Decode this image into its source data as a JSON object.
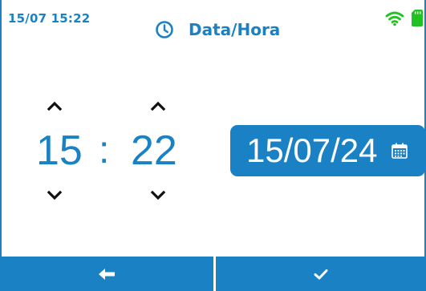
{
  "status": {
    "datetime": "15/07  15:22"
  },
  "header": {
    "title": "Data/Hora",
    "icon": "clock-icon"
  },
  "time": {
    "hour": "15",
    "separator": ":",
    "minute": "22"
  },
  "date": {
    "value": "15/07/24",
    "icon": "calendar-icon"
  },
  "footer": {
    "back_icon": "arrow-left-icon",
    "confirm_icon": "checkmark-icon"
  },
  "colors": {
    "accent": "#1a82c4",
    "signal": "#22c222",
    "background": "#ffffff"
  }
}
